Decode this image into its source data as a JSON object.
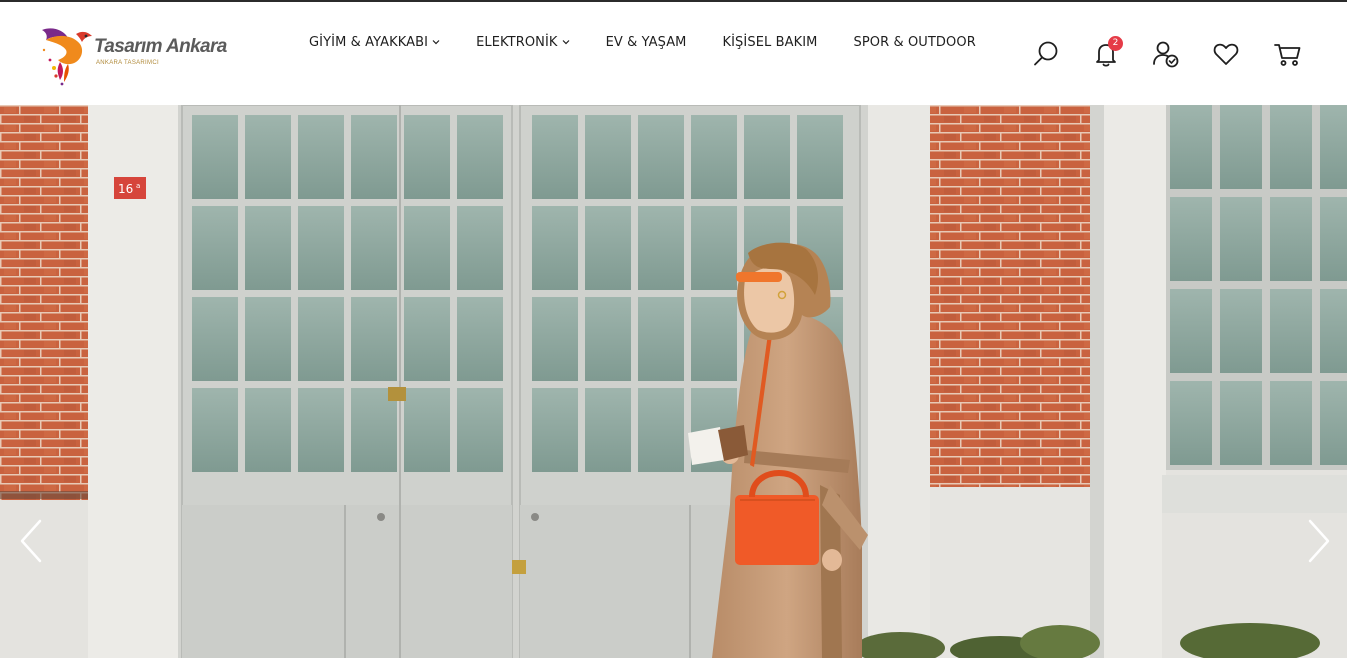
{
  "brand": {
    "name_part1": "Tasarım",
    "name_part2": "Ankara",
    "tagline": "ANKARA TASARIMCI"
  },
  "nav": {
    "items": [
      {
        "label": "GİYİM & AYAKKABI",
        "has_dropdown": true
      },
      {
        "label": "ELEKTRONİK",
        "has_dropdown": true
      },
      {
        "label": "EV & YAŞAM",
        "has_dropdown": false
      },
      {
        "label": "KİŞİSEL BAKIM",
        "has_dropdown": false
      },
      {
        "label": "SPOR & OUTDOOR",
        "has_dropdown": false
      }
    ]
  },
  "header_icons": {
    "search": "search-icon",
    "notifications": "bell-icon",
    "notification_count": "2",
    "account": "user-check-icon",
    "wishlist": "heart-icon",
    "cart": "cart-icon"
  },
  "hero": {
    "door_number": "16",
    "door_number_suffix": "a"
  },
  "colors": {
    "accent": "#e53b47",
    "brick": "#c9623f",
    "glass": "#8ea79f",
    "bag": "#f05a28",
    "coat": "#c49a76"
  }
}
